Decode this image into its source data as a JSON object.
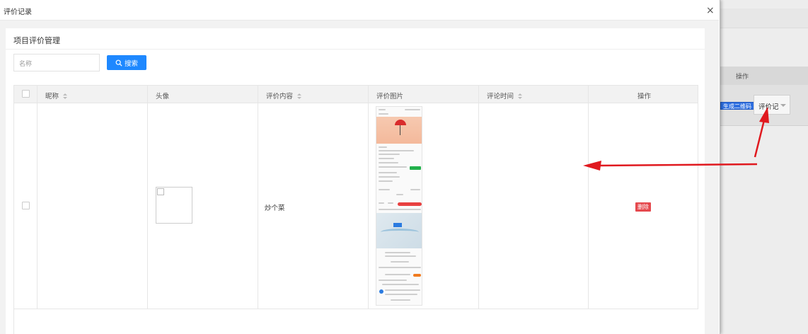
{
  "background": {
    "table_header_label": "操作",
    "qr_button_label": "生成二维码",
    "select_value": "评价记"
  },
  "modal": {
    "title": "评价记录",
    "close_glyph": "×"
  },
  "card": {
    "title": "项目评价管理",
    "search": {
      "placeholder": "名称",
      "button_label": "搜索"
    }
  },
  "table": {
    "columns": [
      {
        "label": "昵称",
        "sortable": true
      },
      {
        "label": "头像",
        "sortable": false
      },
      {
        "label": "评价内容",
        "sortable": true
      },
      {
        "label": "评价图片",
        "sortable": false
      },
      {
        "label": "评论时间",
        "sortable": true
      },
      {
        "label": "操作",
        "sortable": false
      }
    ],
    "rows": [
      {
        "nickname": "",
        "content": "炒个菜",
        "comment_time": "",
        "delete_label": "删除"
      }
    ]
  },
  "colors": {
    "primary": "#1e88ff",
    "danger": "#e5484d",
    "annotation_arrow": "#e0191f"
  }
}
